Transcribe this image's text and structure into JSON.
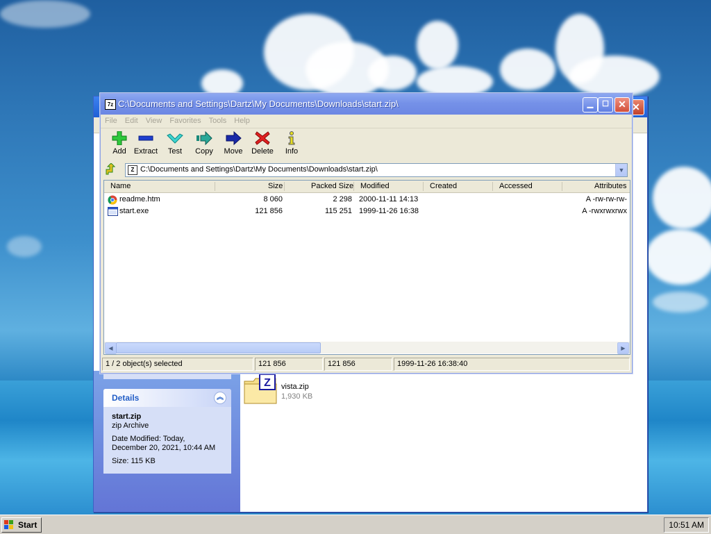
{
  "sevenzip": {
    "title": "C:\\Documents and Settings\\Dartz\\My Documents\\Downloads\\start.zip\\",
    "app_icon": "7z",
    "menu": [
      "File",
      "Edit",
      "View",
      "Favorites",
      "Tools",
      "Help"
    ],
    "toolbar": {
      "add": "Add",
      "extract": "Extract",
      "test": "Test",
      "copy": "Copy",
      "move": "Move",
      "delete": "Delete",
      "info": "Info"
    },
    "address": "C:\\Documents and Settings\\Dartz\\My Documents\\Downloads\\start.zip\\",
    "address_icon": "Z",
    "columns": [
      "Name",
      "Size",
      "Packed Size",
      "Modified",
      "Created",
      "Accessed",
      "Attributes"
    ],
    "files": [
      {
        "name": "readme.htm",
        "size": "8 060",
        "packed": "2 298",
        "modified": "2000-11-11 14:13",
        "created": "",
        "accessed": "",
        "attributes": "A -rw-rw-rw-",
        "icon": "chrome-html-icon"
      },
      {
        "name": "start.exe",
        "size": "121 856",
        "packed": "115 251",
        "modified": "1999-11-26 16:38",
        "created": "",
        "accessed": "",
        "attributes": "A -rwxrwxrwx",
        "icon": "exe-icon"
      }
    ],
    "status": {
      "selected": "1 / 2 object(s) selected",
      "size": "121 856",
      "packed": "121 856",
      "modified": "1999-11-26 16:38:40"
    }
  },
  "explorer": {
    "details": {
      "header": "Details",
      "name": "start.zip",
      "type": "zip Archive",
      "date_label": "Date Modified: Today,",
      "date_value": "December 20, 2021, 10:44 AM",
      "size": "Size: 115 KB"
    },
    "files": [
      {
        "name": "vista.zip",
        "size": "1,930 KB",
        "icon_letter": "Z"
      }
    ]
  },
  "taskbar": {
    "start_label": "Start",
    "clock": "10:51 AM"
  },
  "colors": {
    "title_inactive": "#7591e8",
    "close_red": "#d2503a",
    "details_blue": "#215dc6",
    "taskbar": "#d4d0c8"
  }
}
